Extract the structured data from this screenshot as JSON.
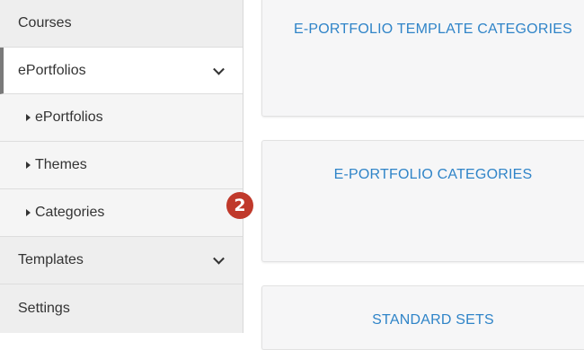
{
  "sidebar": {
    "items": [
      {
        "label": "Courses"
      },
      {
        "label": "ePortfolios"
      },
      {
        "label": "ePortfolios"
      },
      {
        "label": "Themes"
      },
      {
        "label": "Categories"
      },
      {
        "label": "Templates"
      },
      {
        "label": "Settings"
      }
    ]
  },
  "badge": {
    "text": "2",
    "color": "#c0392b"
  },
  "cards": [
    {
      "title": "E-PORTFOLIO TEMPLATE CATEGORIES"
    },
    {
      "title": "E-PORTFOLIO CATEGORIES"
    },
    {
      "title": "STANDARD SETS"
    }
  ],
  "colors": {
    "accent": "#2f84c8",
    "sidebar_bg": "#f2f2f2",
    "active_bar": "#7a7a7a"
  }
}
